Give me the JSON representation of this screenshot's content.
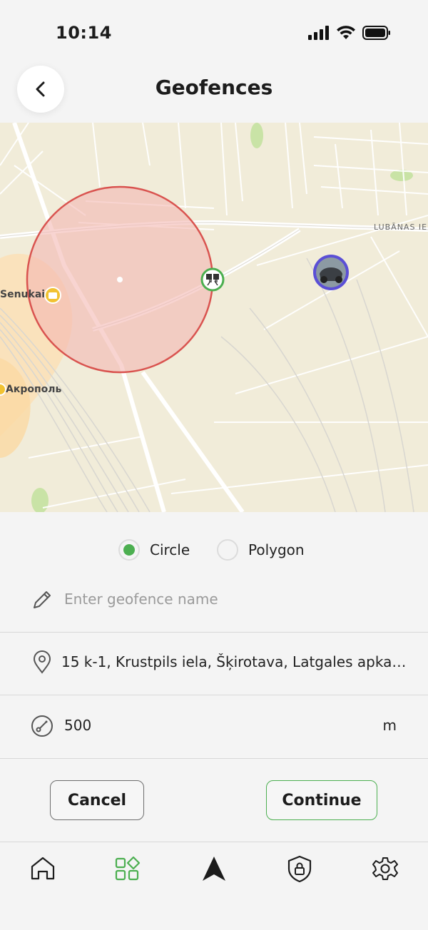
{
  "status": {
    "time": "10:14"
  },
  "header": {
    "title": "Geofences"
  },
  "map": {
    "labels": {
      "road": "LUBĀNAS IE",
      "poi_1": "Senukai",
      "poi_2": "Акрополь"
    }
  },
  "shape_selector": {
    "options": [
      {
        "label": "Circle",
        "selected": true
      },
      {
        "label": "Polygon",
        "selected": false
      }
    ]
  },
  "form": {
    "name_placeholder": "Enter geofence name",
    "address": "15 k-1, Krustpils iela, Šķirotava, Latgales apka…",
    "radius": "500",
    "radius_unit": "m"
  },
  "actions": {
    "cancel_label": "Cancel",
    "continue_label": "Continue"
  },
  "nav": {
    "items": [
      "home-icon",
      "widgets-icon",
      "navigation-icon",
      "security-icon",
      "settings-icon"
    ],
    "active_index": 1
  },
  "colors": {
    "accent": "#4caf50",
    "fence_stroke": "#d9534f",
    "fence_fill": "#f4b8b2",
    "vehicle_ring": "#5b4fd6"
  }
}
